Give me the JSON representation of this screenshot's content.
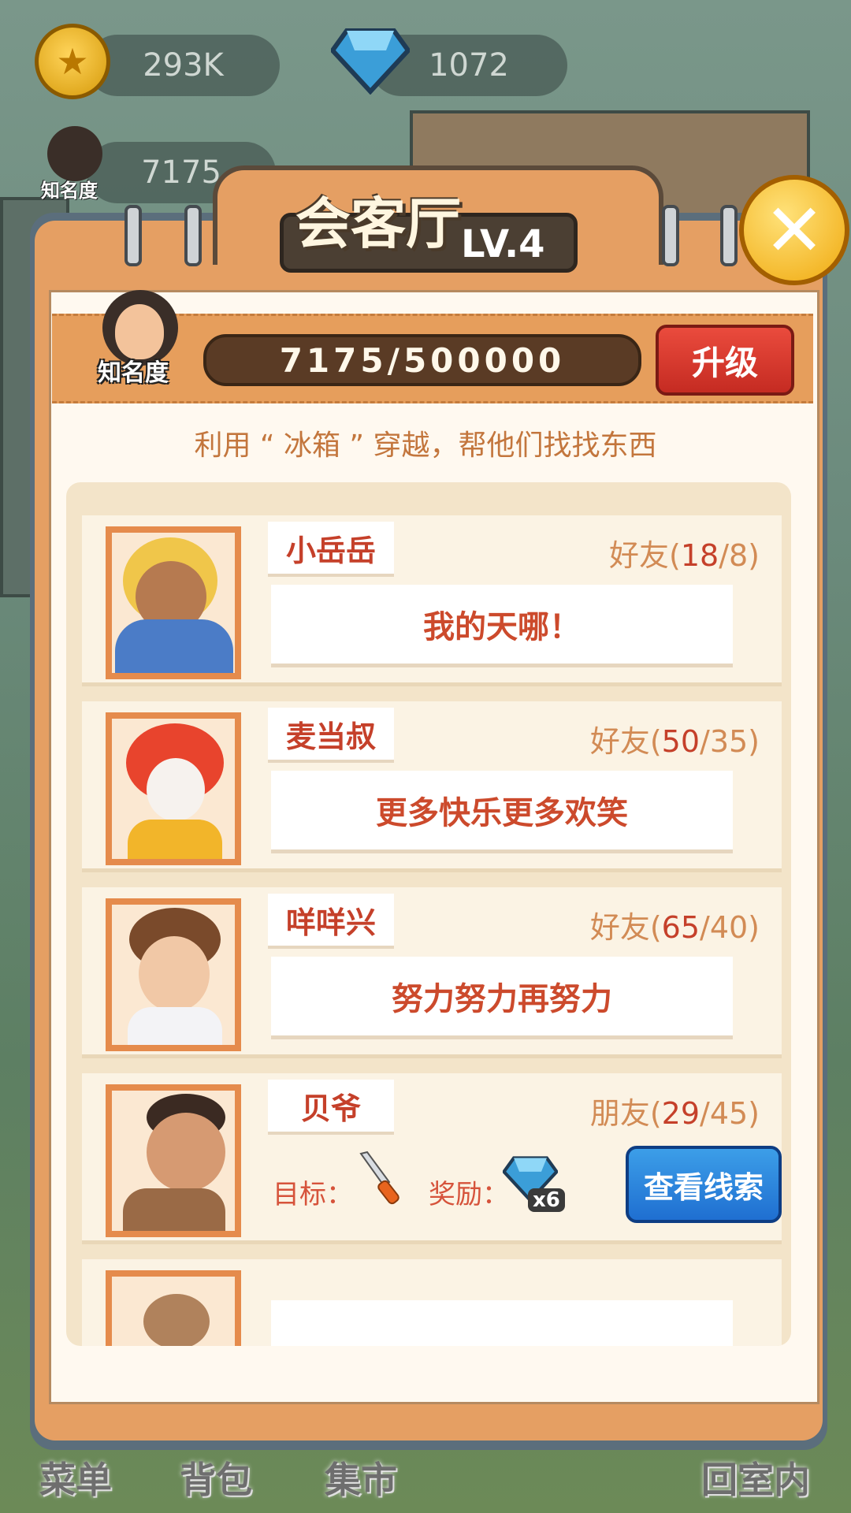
{
  "hud": {
    "coins": "293K",
    "gems": "1072",
    "fame": "7175",
    "fame_label": "知名度"
  },
  "panel": {
    "title": "会客厅",
    "level": "LV.4",
    "close_icon": "close-icon",
    "fame_label": "知名度",
    "fame_progress": "7175/500000",
    "upgrade_label": "升级",
    "hint": "利用 “ 冰箱 ” 穿越，帮他们找找东西"
  },
  "characters": [
    {
      "name": "小岳岳",
      "relation": "好友(",
      "current": "18",
      "max": "/8)",
      "quote": "我的天哪！"
    },
    {
      "name": "麦当叔",
      "relation": "好友(",
      "current": "50",
      "max": "/35)",
      "quote": "更多快乐更多欢笑"
    },
    {
      "name": "咩咩兴",
      "relation": "好友(",
      "current": "65",
      "max": "/40)",
      "quote": "努力努力再努力"
    },
    {
      "name": "贝爷",
      "relation": "朋友(",
      "current": "29",
      "max": "/45)",
      "goal_label": "目标：",
      "reward_label": "奖励：",
      "reward_count": "x6",
      "clue_button": "查看线索"
    }
  ],
  "bottom_nav": {
    "menu": "菜单",
    "bag": "背包",
    "market": "集市",
    "back_indoor": "回室内"
  },
  "colors": {
    "panel_orange": "#e59f63",
    "accent_red": "#c5402a",
    "upgrade_red": "#d83a2e",
    "clue_blue": "#2a84dc"
  }
}
